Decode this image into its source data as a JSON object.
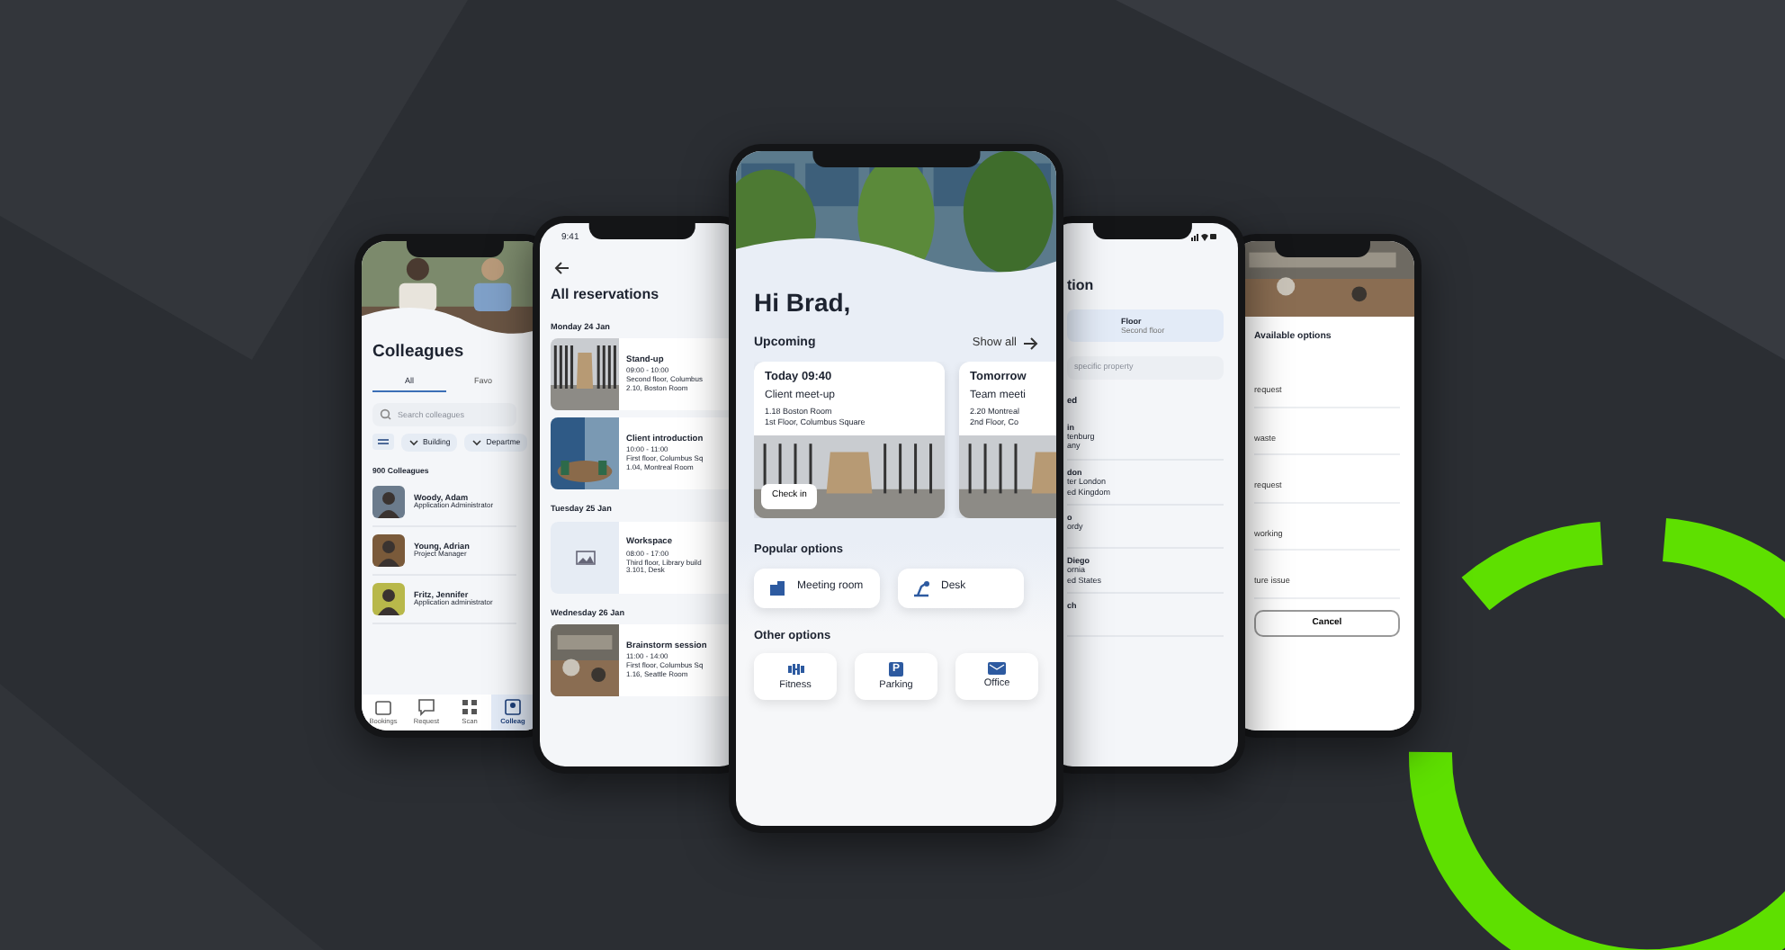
{
  "phones": [
    {
      "kind": "colleagues",
      "title": "Colleagues",
      "tabs": [
        {
          "label": "All",
          "selected": true
        },
        {
          "label": "Favo",
          "selected": false
        }
      ],
      "search": {
        "placeholder": "Search colleagues"
      },
      "filters": [
        "Building",
        "Departme"
      ],
      "count": "900 Colleagues",
      "people": [
        {
          "name": "Woody, Adam",
          "role": "Application Administrator"
        },
        {
          "name": "Young, Adrian",
          "role": "Project Manager"
        },
        {
          "name": "Fritz, Jennifer",
          "role": "Application administrator"
        }
      ],
      "nav": [
        {
          "label": "Bookings",
          "selected": false
        },
        {
          "label": "Request",
          "selected": false
        },
        {
          "label": "Scan",
          "selected": false
        },
        {
          "label": "Colleag",
          "selected": true
        }
      ]
    },
    {
      "kind": "reservations",
      "time": "9:41",
      "title": "All reservations",
      "days": [
        {
          "day": "Monday 24 Jan",
          "items": [
            {
              "title": "Stand-up",
              "time": "09:00 - 10:00",
              "place": "Second floor, Columbus",
              "room": "2.10, Boston Room"
            },
            {
              "title": "Client introduction",
              "time": "10:00 - 11:00",
              "place": "First floor, Columbus Sq",
              "room": "1.04, Montreal Room"
            }
          ]
        },
        {
          "day": "Tuesday 25 Jan",
          "items": [
            {
              "kind": "placeholder",
              "title": "Workspace",
              "time": "08:00 - 17:00",
              "place": "Third floor, Library build",
              "room": "3.101, Desk"
            }
          ]
        },
        {
          "day": "Wednesday 26 Jan",
          "items": [
            {
              "title": "Brainstorm session",
              "time": "11:00 - 14:00",
              "place": "First floor, Columbus Sq",
              "room": "1.16, Seattle Room"
            }
          ]
        }
      ]
    },
    {
      "kind": "home",
      "greeting": "Hi Brad,",
      "upcoming": "Upcoming",
      "show_all": "Show all",
      "cards": [
        {
          "when": "Today 09:40",
          "title": "Client meet-up",
          "room": "1.18 Boston Room",
          "place": "1st Floor, Columbus Square",
          "action": "Check in"
        },
        {
          "when": "Tomorrow",
          "title": "Team meeti",
          "room": "2.20 Montreal",
          "place": "2nd Floor, Co"
        }
      ],
      "popular_title": "Popular options",
      "popular": [
        {
          "kind": "meeting",
          "label": "Meeting room"
        },
        {
          "kind": "desk",
          "label": "Desk"
        }
      ],
      "other_title": "Other options",
      "other": [
        {
          "kind": "fitness",
          "label": "Fitness"
        },
        {
          "kind": "parking",
          "glyph": "P",
          "label": "Parking"
        },
        {
          "kind": "office",
          "label": "Office"
        }
      ]
    },
    {
      "kind": "location",
      "title": "tion",
      "floor_label": "Floor",
      "floor_value": "Second floor",
      "search": {
        "placeholder": "specific property"
      },
      "section": "ed",
      "places": [
        {
          "name": "in",
          "lines": [
            "tenburg",
            "any"
          ]
        },
        {
          "name": "don",
          "lines": [
            "ter London",
            "ed Kingdom"
          ]
        },
        {
          "name": "o",
          "lines": [
            "ordy"
          ]
        },
        {
          "name": "Diego",
          "lines": [
            "ornia",
            "ed States"
          ]
        },
        {
          "name": "ch"
        }
      ]
    },
    {
      "kind": "options",
      "title": "Available options",
      "options": [
        "request",
        "waste",
        "request",
        "working",
        "ture issue"
      ],
      "cancel": "Cancel"
    }
  ]
}
